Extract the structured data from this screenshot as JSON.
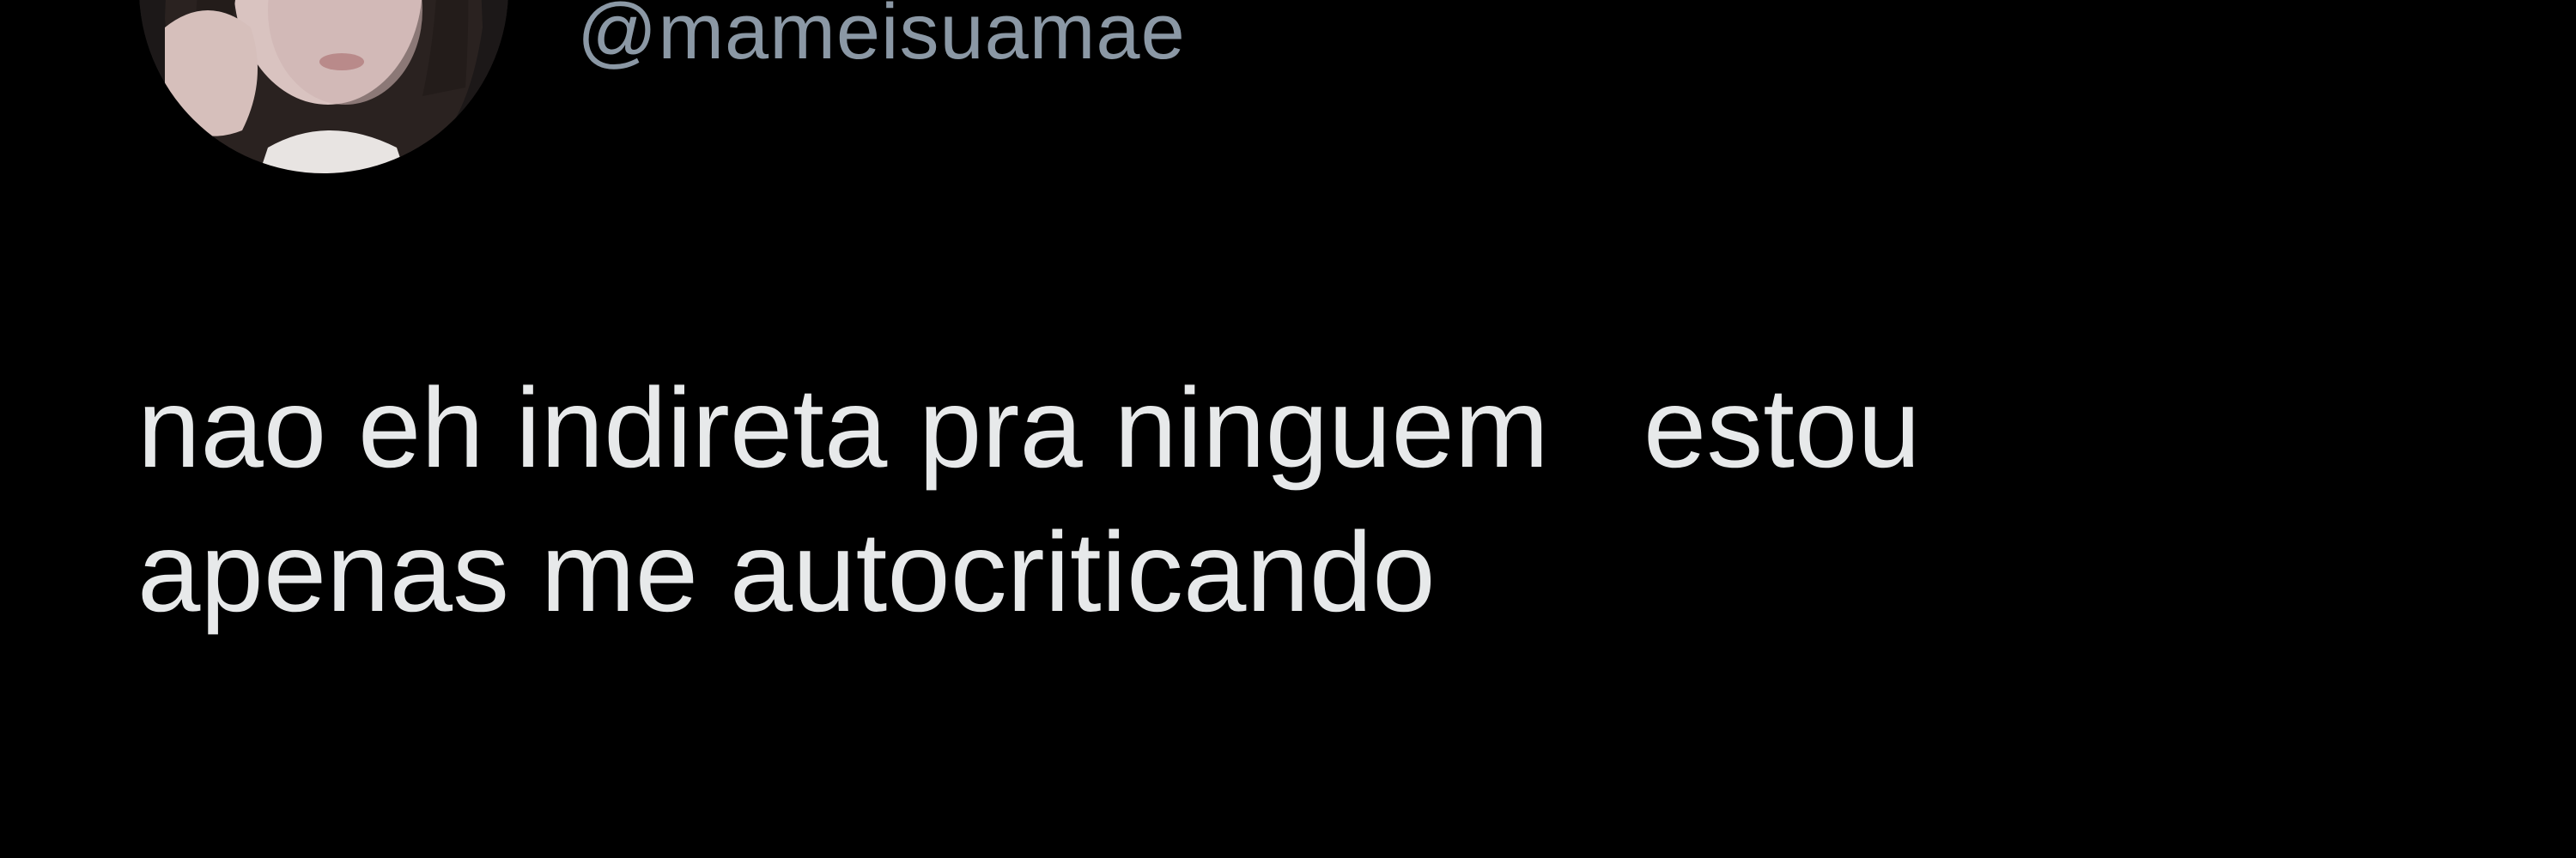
{
  "tweet": {
    "handle": "@mameisuamae",
    "text_lines": [
      "nao eh indireta pra ninguem   estou",
      "apenas me autocriticando"
    ]
  },
  "colors": {
    "background": "#000000",
    "text": "#e7e9ea",
    "handle": "#8b98a5"
  },
  "icons": {
    "avatar": "profile-photo"
  }
}
